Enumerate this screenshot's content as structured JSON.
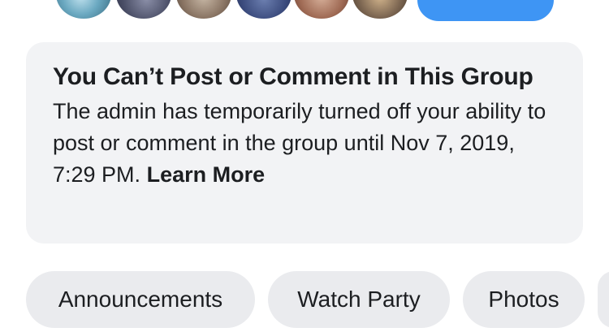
{
  "notice": {
    "title": "You Can’t Post or Comment in This Group",
    "body": "The admin has temporarily turned off your ability to post or comment in the group until Nov 7, 2019, 7:29 PM.",
    "link": "Learn More"
  },
  "tabs": [
    {
      "label": "Announcements"
    },
    {
      "label": "Watch Party"
    },
    {
      "label": "Photos"
    }
  ],
  "colors": {
    "accent": "#3e95f4",
    "card_bg": "#f2f3f5",
    "chip_bg": "#eaebee",
    "text": "#1c1e21"
  }
}
